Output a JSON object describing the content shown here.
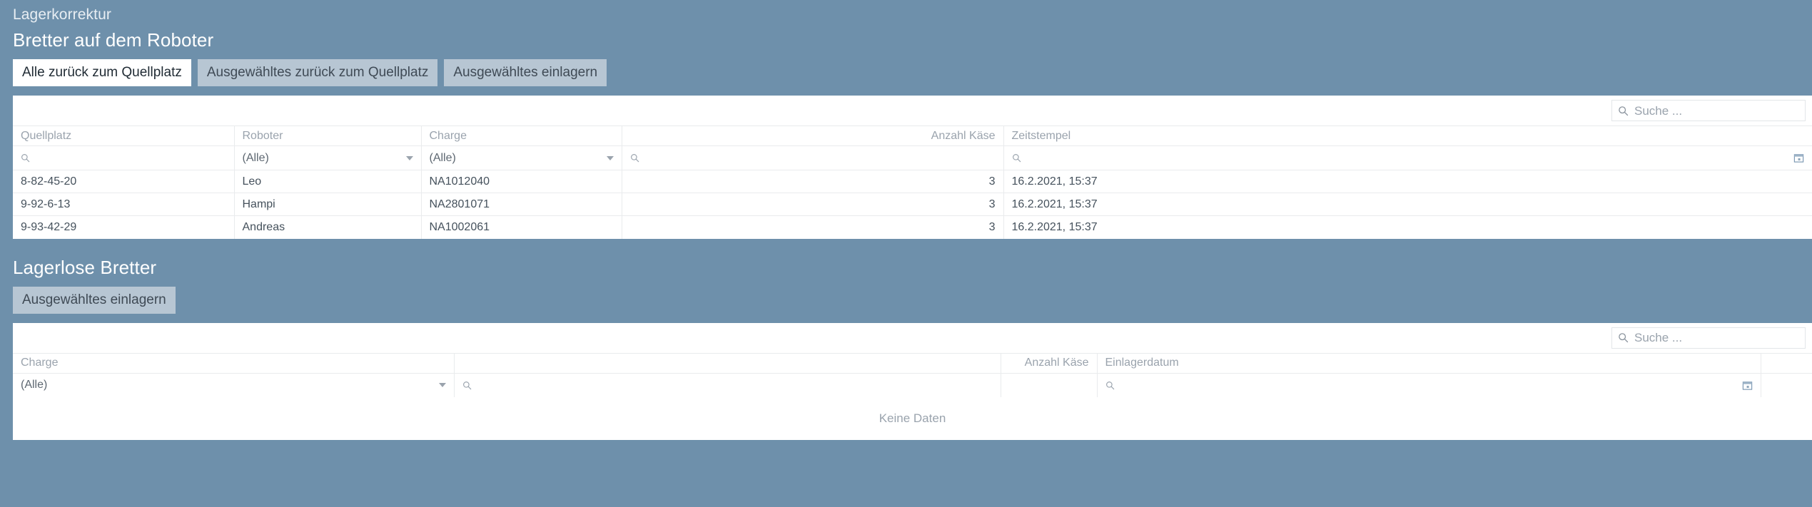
{
  "breadcrumb": "Lagerkorrektur",
  "section1": {
    "title": "Bretter auf dem Roboter",
    "buttons": [
      {
        "label": "Alle zurück zum Quellplatz",
        "primary": true
      },
      {
        "label": "Ausgewähltes zurück zum Quellplatz",
        "primary": false
      },
      {
        "label": "Ausgewähltes einlagern",
        "primary": false
      }
    ],
    "search_placeholder": "Suche ...",
    "columns": [
      "Quellplatz",
      "Roboter",
      "Charge",
      "Anzahl Käse",
      "Zeitstempel"
    ],
    "filters": {
      "quellplatz": "",
      "roboter": "(Alle)",
      "charge": "(Alle)",
      "anzahl": "",
      "zeitstempel": ""
    },
    "rows": [
      {
        "quellplatz": "8-82-45-20",
        "roboter": "Leo",
        "charge": "NA1012040",
        "anzahl": "3",
        "zeitstempel": "16.2.2021, 15:37"
      },
      {
        "quellplatz": "9-92-6-13",
        "roboter": "Hampi",
        "charge": "NA2801071",
        "anzahl": "3",
        "zeitstempel": "16.2.2021, 15:37"
      },
      {
        "quellplatz": "9-93-42-29",
        "roboter": "Andreas",
        "charge": "NA1002061",
        "anzahl": "3",
        "zeitstempel": "16.2.2021, 15:37"
      }
    ]
  },
  "section2": {
    "title": "Lagerlose Bretter",
    "buttons": [
      {
        "label": "Ausgewähltes einlagern",
        "primary": false
      }
    ],
    "search_placeholder": "Suche ...",
    "columns": [
      "Charge",
      "",
      "Anzahl Käse",
      "Einlagerdatum",
      ""
    ],
    "filters": {
      "charge": "(Alle)",
      "anzahl": "",
      "einlagerdatum": ""
    },
    "empty_message": "Keine Daten"
  },
  "colors": {
    "background": "#6e90ab",
    "card": "#ffffff",
    "button": "#b7c6d3",
    "button_primary": "#ffffff",
    "header_text": "#9aa3ad",
    "cell_text": "#45515c"
  }
}
